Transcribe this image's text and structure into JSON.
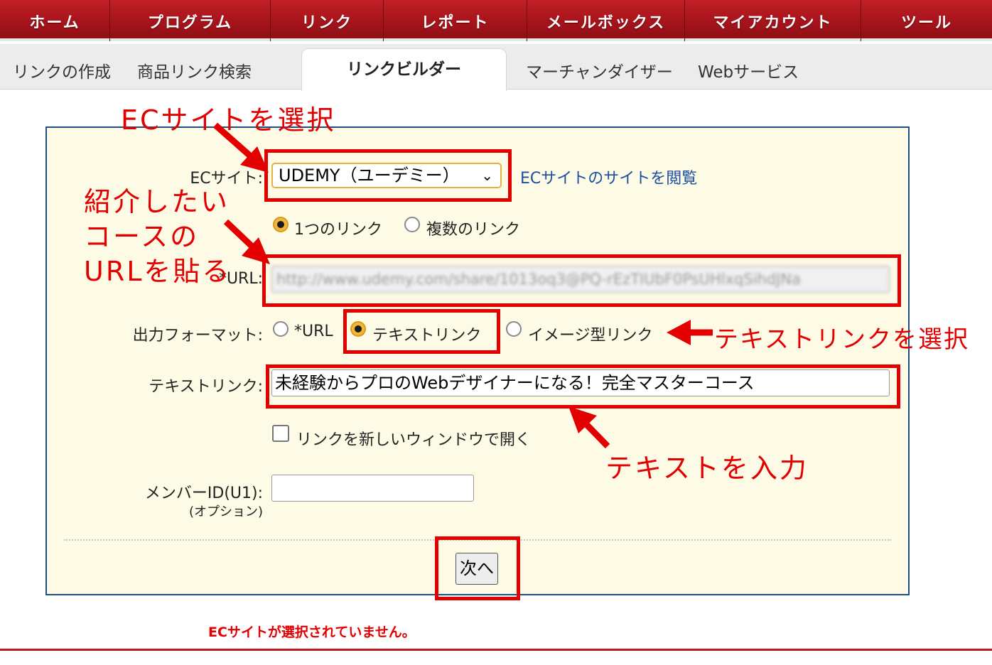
{
  "top_nav": [
    "ホーム",
    "プログラム",
    "リンク",
    "レポート",
    "メールボックス",
    "マイアカウント",
    "ツール"
  ],
  "sub_nav": {
    "tabs": [
      "リンクの作成",
      "商品リンク検索",
      "リンクビルダー",
      "マーチャンダイザー",
      "Webサービス"
    ],
    "active": "リンクビルダー"
  },
  "form": {
    "ec_site_label": "ECサイト:",
    "ec_site_value": "UDEMY（ユーデミー）",
    "ec_site_link": "ECサイトのサイトを閲覧",
    "link_count_options": [
      "1つのリンク",
      "複数のリンク"
    ],
    "link_count_selected": "1つのリンク",
    "url_label": "*URL:",
    "url_value": "http://www.udemy.com/share/1013oq3@PQ-rEzTIUbF0PsUHlxqSihdJNa",
    "format_label": "出力フォーマット:",
    "format_options": [
      "*URL",
      "テキストリンク",
      "イメージ型リンク"
    ],
    "format_selected": "テキストリンク",
    "text_link_label": "テキストリンク:",
    "text_link_value": "未経験からプロのWebデザイナーになる！完全マスターコース",
    "new_window_label": "リンクを新しいウィンドウで開く",
    "new_window_checked": false,
    "member_id_label": "メンバーID(U1):",
    "member_id_note": "(オプション)",
    "member_id_value": "",
    "next_button": "次へ"
  },
  "error_message": "ECサイトが選択されていません。",
  "annotations": {
    "select_ec": "ECサイトを選択",
    "paste_url_1": "紹介したい",
    "paste_url_2": "コースの",
    "paste_url_3": "URLを貼る",
    "select_text_link": "テキストリンクを選択",
    "enter_text": "テキストを入力"
  },
  "colors": {
    "nav_red": "#a7141b",
    "panel_bg": "#fdfbe6",
    "panel_border": "#1f4f7f",
    "annotation_red": "#e30000",
    "link_blue": "#1a4fa0"
  }
}
